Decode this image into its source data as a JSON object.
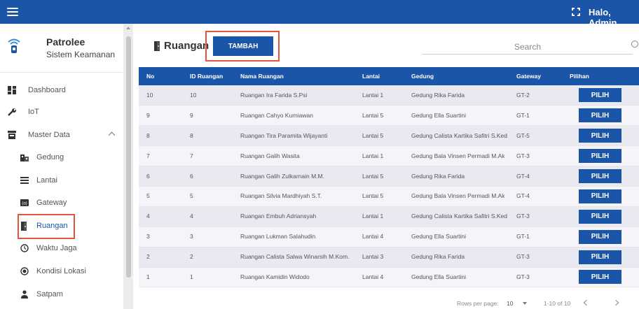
{
  "header": {
    "greeting": "Halo, Admin"
  },
  "brand": {
    "title": "Patrolee",
    "subtitle": "Sistem Keamanan"
  },
  "sidebar": {
    "items": [
      {
        "label": "Dashboard",
        "icon": "dashboard-icon"
      },
      {
        "label": "IoT",
        "icon": "wrench-icon"
      },
      {
        "label": "Master Data",
        "icon": "master-data-icon"
      }
    ],
    "sub_items": [
      {
        "label": "Gedung",
        "icon": "building-icon"
      },
      {
        "label": "Lantai",
        "icon": "list-icon"
      },
      {
        "label": "Gateway",
        "icon": "gateway-icon"
      },
      {
        "label": "Ruangan",
        "icon": "door-icon"
      },
      {
        "label": "Waktu Jaga",
        "icon": "clock-icon"
      },
      {
        "label": "Kondisi Lokasi",
        "icon": "radio-icon"
      },
      {
        "label": "Satpam",
        "icon": "person-icon"
      }
    ],
    "active": "Ruangan"
  },
  "page": {
    "title": "Ruangan",
    "add_label": "TAMBAH",
    "search_placeholder": "Search"
  },
  "table": {
    "headers": [
      "No",
      "ID Ruangan",
      "Nama Ruangan",
      "Lantai",
      "Gedung",
      "Gateway",
      "Pilihan"
    ],
    "rows": [
      [
        "10",
        "10",
        "Ruangan Ira Farida S.Psi",
        "Lantai 1",
        "Gedung Rika Farida",
        "GT-2"
      ],
      [
        "9",
        "9",
        "Ruangan Cahyo Kurniawan",
        "Lantai 5",
        "Gedung Ella Suartini",
        "GT-1"
      ],
      [
        "8",
        "8",
        "Ruangan Tira Paramita Wijayanti",
        "Lantai 5",
        "Gedung Calista Kartika Safitri S.Ked",
        "GT-5"
      ],
      [
        "7",
        "7",
        "Ruangan Galih Wasita",
        "Lantai 1",
        "Gedung Bala Vinsen Permadi M.Ak",
        "GT-3"
      ],
      [
        "6",
        "6",
        "Ruangan Galih Zulkarnain M.M.",
        "Lantai 5",
        "Gedung Rika Farida",
        "GT-4"
      ],
      [
        "5",
        "5",
        "Ruangan Silvia Mardhiyah S.T.",
        "Lantai 5",
        "Gedung Bala Vinsen Permadi M.Ak",
        "GT-4"
      ],
      [
        "4",
        "4",
        "Ruangan Embuh Adriansyah",
        "Lantai 1",
        "Gedung Calista Kartika Safitri S.Ked",
        "GT-3"
      ],
      [
        "3",
        "3",
        "Ruangan Lukman Salahudin",
        "Lantai 4",
        "Gedung Ella Suartini",
        "GT-1"
      ],
      [
        "2",
        "2",
        "Ruangan Calista Salwa Winarsih M.Kom.",
        "Lantai 3",
        "Gedung Rika Farida",
        "GT-3"
      ],
      [
        "1",
        "1",
        "Ruangan Kamidin Widodo",
        "Lantai 4",
        "Gedung Ella Suartini",
        "GT-3"
      ]
    ],
    "action_label": "PILIH"
  },
  "pagination": {
    "rows_per_page_label": "Rows per page:",
    "rows_per_page": "10",
    "range": "1-10 of 10"
  },
  "colors": {
    "primary": "#1b55a8",
    "highlight": "#e8543a"
  }
}
